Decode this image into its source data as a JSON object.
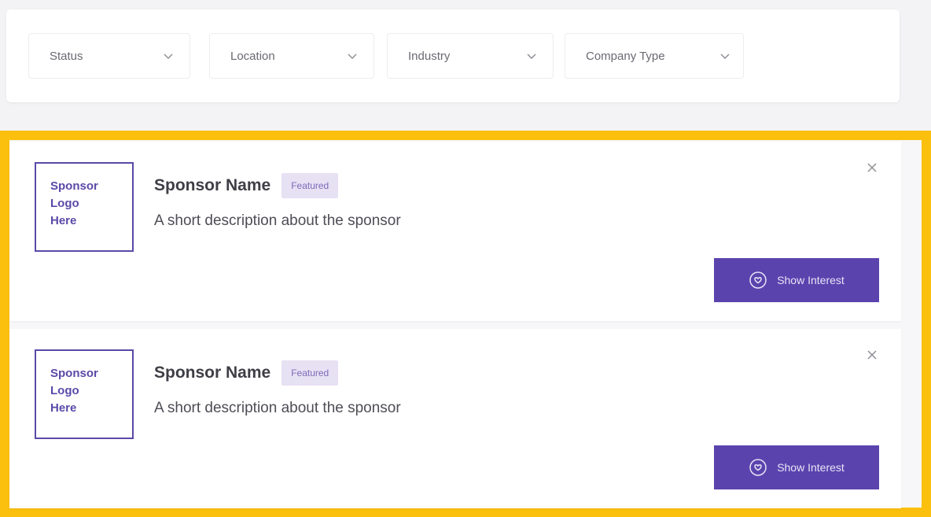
{
  "filters": [
    {
      "label": "Status"
    },
    {
      "label": "Location"
    },
    {
      "label": "Industry"
    },
    {
      "label": "Company Type"
    }
  ],
  "sponsors": [
    {
      "logo_lines": [
        "Sponsor",
        "Logo",
        "Here"
      ],
      "name": "Sponsor Name",
      "badge": "Featured",
      "description": "A short description about the sponsor",
      "button_label": "Show Interest"
    },
    {
      "logo_lines": [
        "Sponsor",
        "Logo",
        "Here"
      ],
      "name": "Sponsor Name",
      "badge": "Featured",
      "description": "A short description about the sponsor",
      "button_label": "Show Interest"
    }
  ],
  "colors": {
    "accent": "#5b43ae",
    "highlight_border": "#fbbf0d",
    "badge_bg": "#e7e1f4"
  },
  "icons": {
    "filter_chevron": "chevron-down-icon",
    "close": "close-icon",
    "button_icon": "heart-hand-icon"
  }
}
